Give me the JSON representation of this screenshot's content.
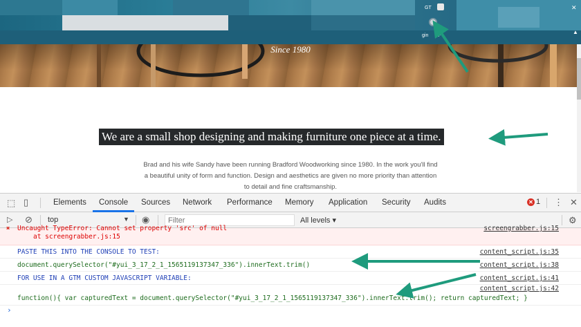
{
  "colors": {
    "arrow": "#1f9b7d",
    "accent": "#1a73e8",
    "error": "#d93025"
  },
  "browser_bar": {
    "label_gt": "GT",
    "label_gin": "gin"
  },
  "hero": {
    "since": "Since 1980"
  },
  "page": {
    "headline": "We are a small shop designing and making furniture one piece at a time.",
    "intro": "Brad and his wife Sandy have been running Bradford Woodworking since 1980. In the work you'll find a beautiful unity of form and function. Design and aesthetics are given no more priority than attention to detail and fine craftsmanship."
  },
  "devtools": {
    "tabs": [
      "Elements",
      "Console",
      "Sources",
      "Network",
      "Performance",
      "Memory",
      "Application",
      "Security",
      "Audits"
    ],
    "active_tab": "Console",
    "error_count": "1",
    "context": "top",
    "filter_placeholder": "Filter",
    "levels": "All levels ▾",
    "console": {
      "error_line1": "Uncaught TypeError: Cannot set property 'src' of null",
      "error_line2": "at screengrabber.js:15",
      "error_source": "screengrabber.js:15",
      "lines": [
        {
          "text": "PASTE THIS INTO THE CONSOLE TO TEST:",
          "source": "content_script.js:35"
        },
        {
          "text": "document.querySelector(\"#yui_3_17_2_1_1565119137347_336\").innerText.trim()",
          "source": "content_script.js:38"
        },
        {
          "text": "FOR USE IN A GTM CUSTOM JAVASCRIPT VARIABLE:",
          "source": "content_script.js:41"
        },
        {
          "text": "function(){ var capturedText = document.querySelector(\"#yui_3_17_2_1_1565119137347_336\").innerText.trim(); return capturedText; }",
          "source": "content_script.js:42"
        }
      ],
      "prompt": "›"
    }
  }
}
